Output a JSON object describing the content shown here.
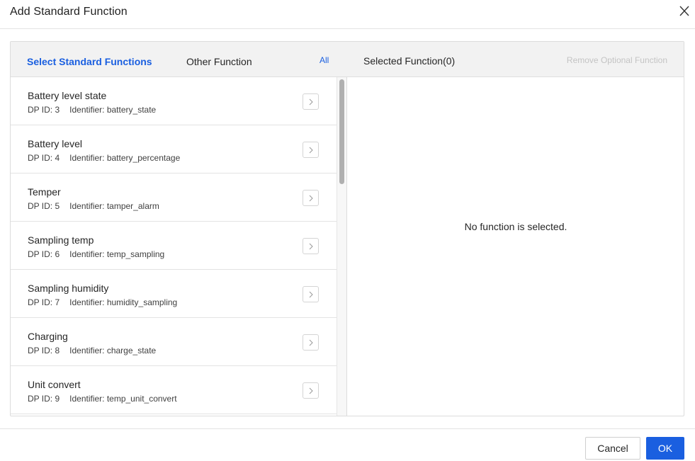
{
  "dialog": {
    "title": "Add Standard Function",
    "close_icon": "close-icon"
  },
  "left_panel": {
    "tabs": [
      {
        "label": "Select Standard Functions",
        "active": true
      },
      {
        "label": "Other Function",
        "active": false
      }
    ],
    "all_link": "All",
    "items": [
      {
        "name": "Battery level state",
        "dp_id": "DP ID: 3",
        "identifier": "Identifier: battery_state"
      },
      {
        "name": "Battery level",
        "dp_id": "DP ID: 4",
        "identifier": "Identifier: battery_percentage"
      },
      {
        "name": "Temper",
        "dp_id": "DP ID: 5",
        "identifier": "Identifier: tamper_alarm"
      },
      {
        "name": "Sampling temp",
        "dp_id": "DP ID: 6",
        "identifier": "Identifier: temp_sampling"
      },
      {
        "name": "Sampling humidity",
        "dp_id": "DP ID: 7",
        "identifier": "Identifier: humidity_sampling"
      },
      {
        "name": "Charging",
        "dp_id": "DP ID: 8",
        "identifier": "Identifier: charge_state"
      },
      {
        "name": "Unit convert",
        "dp_id": "DP ID: 9",
        "identifier": "Identifier: temp_unit_convert"
      }
    ],
    "add_icon": "chevron-right-icon"
  },
  "right_panel": {
    "title": "Selected Function(0)",
    "remove_optional": "Remove Optional Function",
    "empty_text": "No function is selected."
  },
  "footer": {
    "cancel_label": "Cancel",
    "ok_label": "OK"
  },
  "colors": {
    "accent": "#1a5fe0",
    "header_bg": "#f2f2f2",
    "disabled_text": "#c4c4c4"
  }
}
